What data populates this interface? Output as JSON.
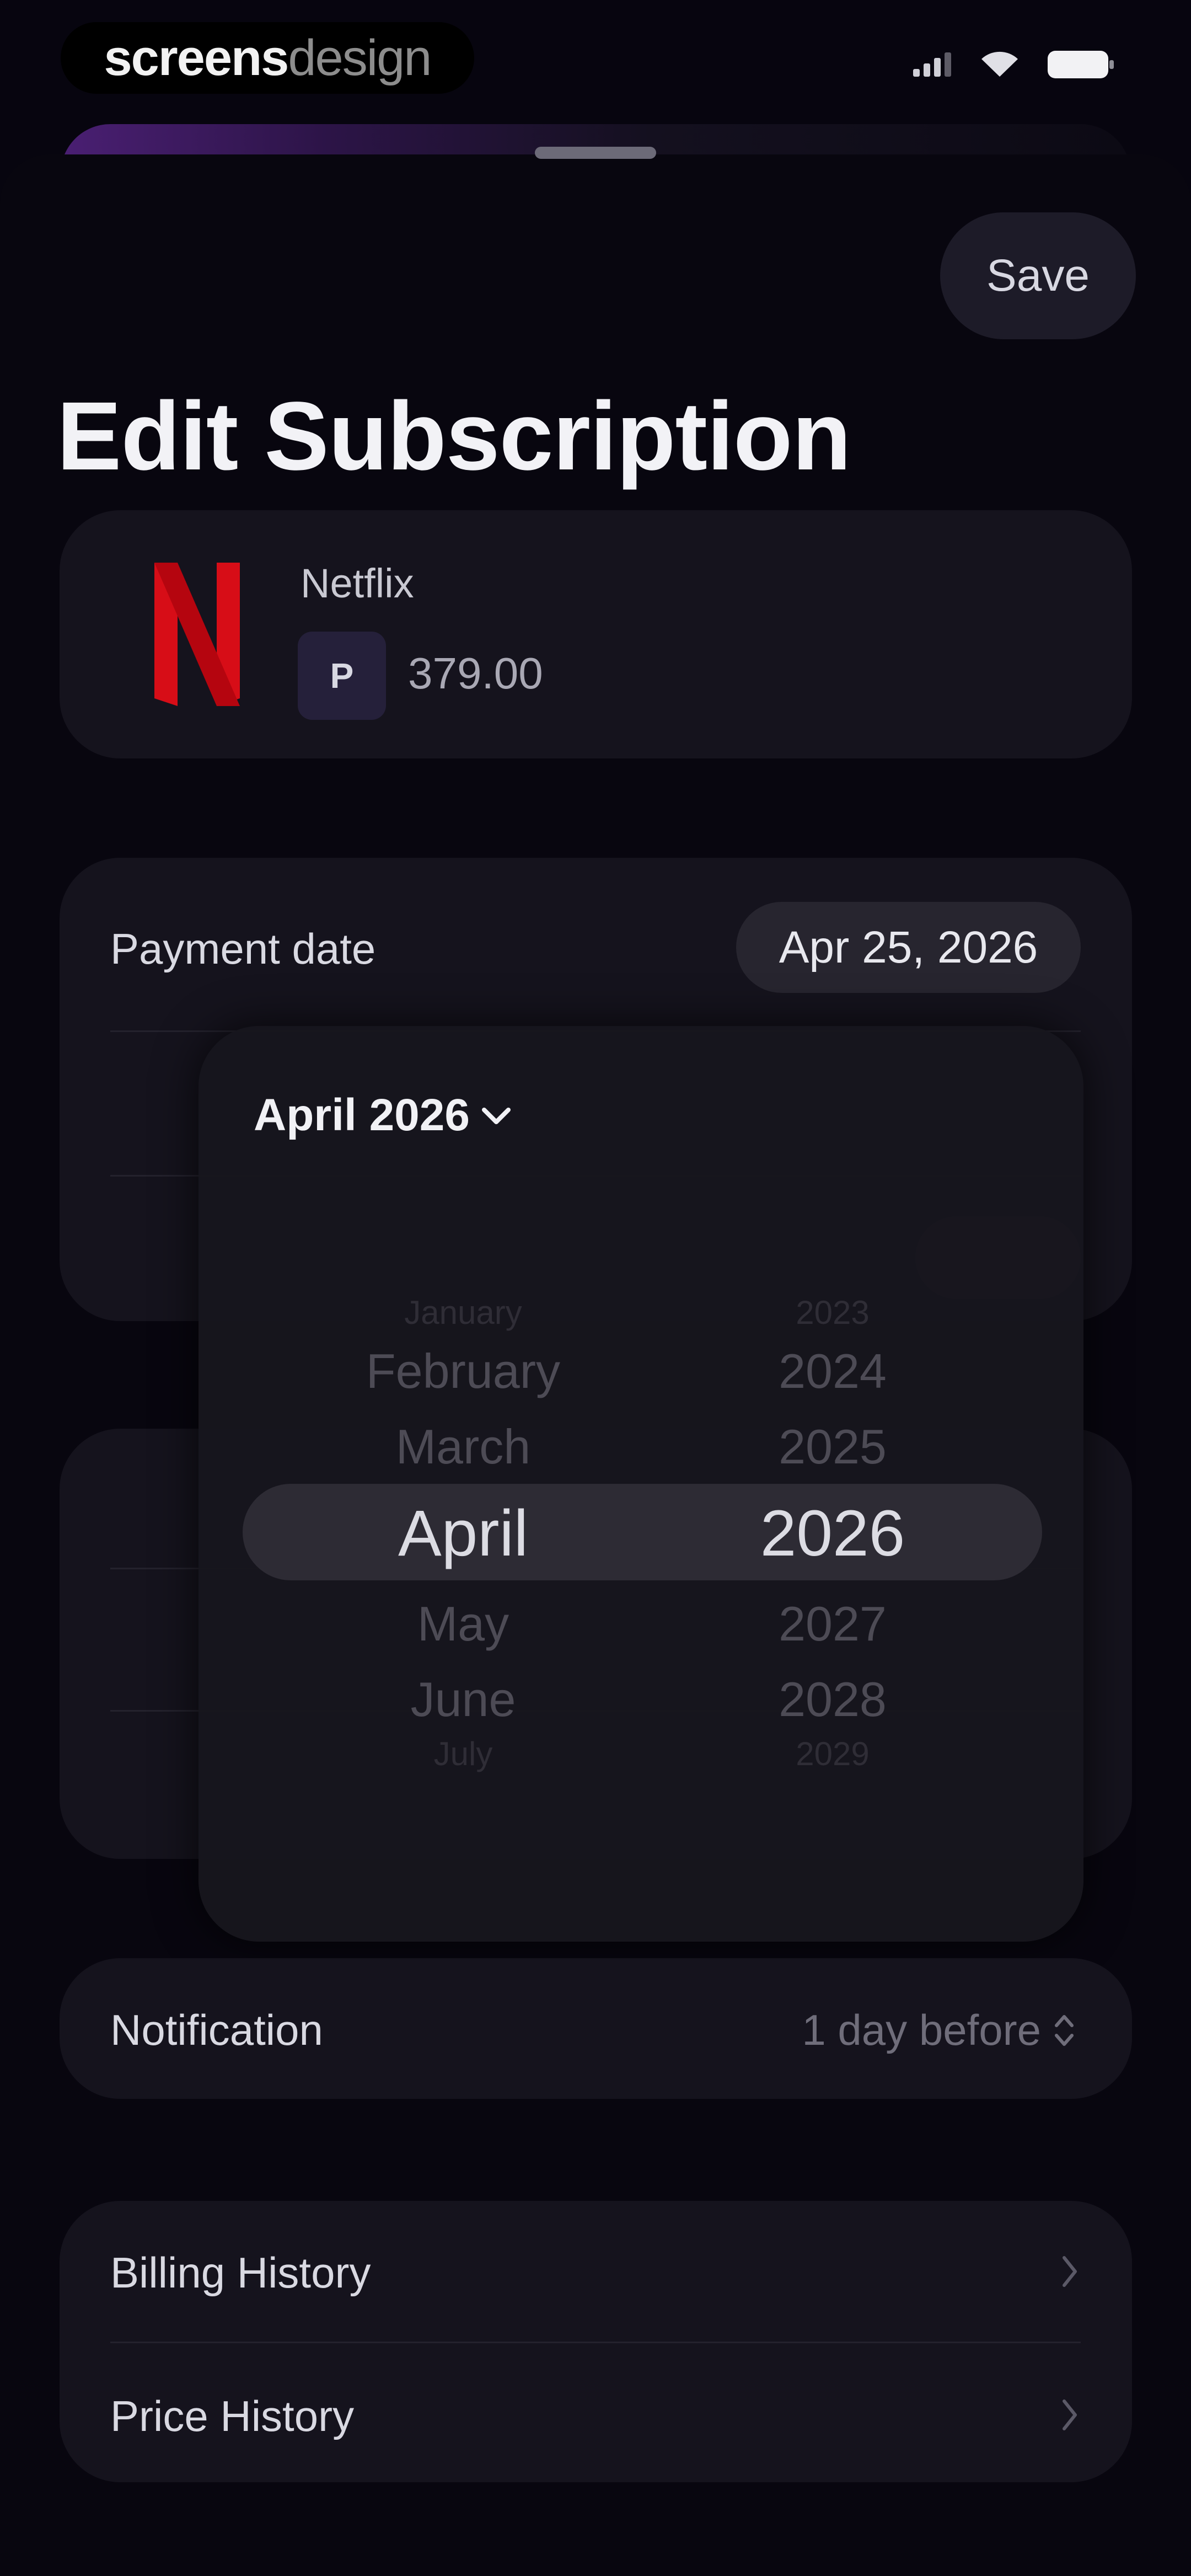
{
  "status_bar": {
    "watermark_part1": "screens",
    "watermark_part2": "design",
    "signal_icon": "signal-icon",
    "wifi_icon": "wifi-icon",
    "battery_icon": "battery-icon"
  },
  "header": {
    "save_label": "Save",
    "title": "Edit Subscription"
  },
  "subscription": {
    "name": "Netflix",
    "currency_symbol": "P",
    "price": "379.00",
    "logo_icon": "netflix-logo-icon",
    "brand_color": "#d70d17"
  },
  "billing_group": {
    "payment_date_label": "Payment date",
    "payment_date_value": "Apr 25, 2026"
  },
  "date_picker": {
    "header": "April 2026",
    "header_icon": "chevron-down-icon",
    "months": {
      "far_above": "January",
      "above2": "February",
      "above1": "March",
      "selected": "April",
      "below1": "May",
      "below2": "June",
      "far_below": "July"
    },
    "years": {
      "far_above": "2023",
      "above2": "2024",
      "above1": "2025",
      "selected": "2026",
      "below1": "2027",
      "below2": "2028",
      "far_below": "2029"
    }
  },
  "notification": {
    "label": "Notification",
    "value": "1 day before",
    "icon": "up-down-chevron-icon"
  },
  "history": {
    "billing_history_label": "Billing History",
    "price_history_label": "Price History",
    "chevron_icon": "chevron-right-icon"
  }
}
